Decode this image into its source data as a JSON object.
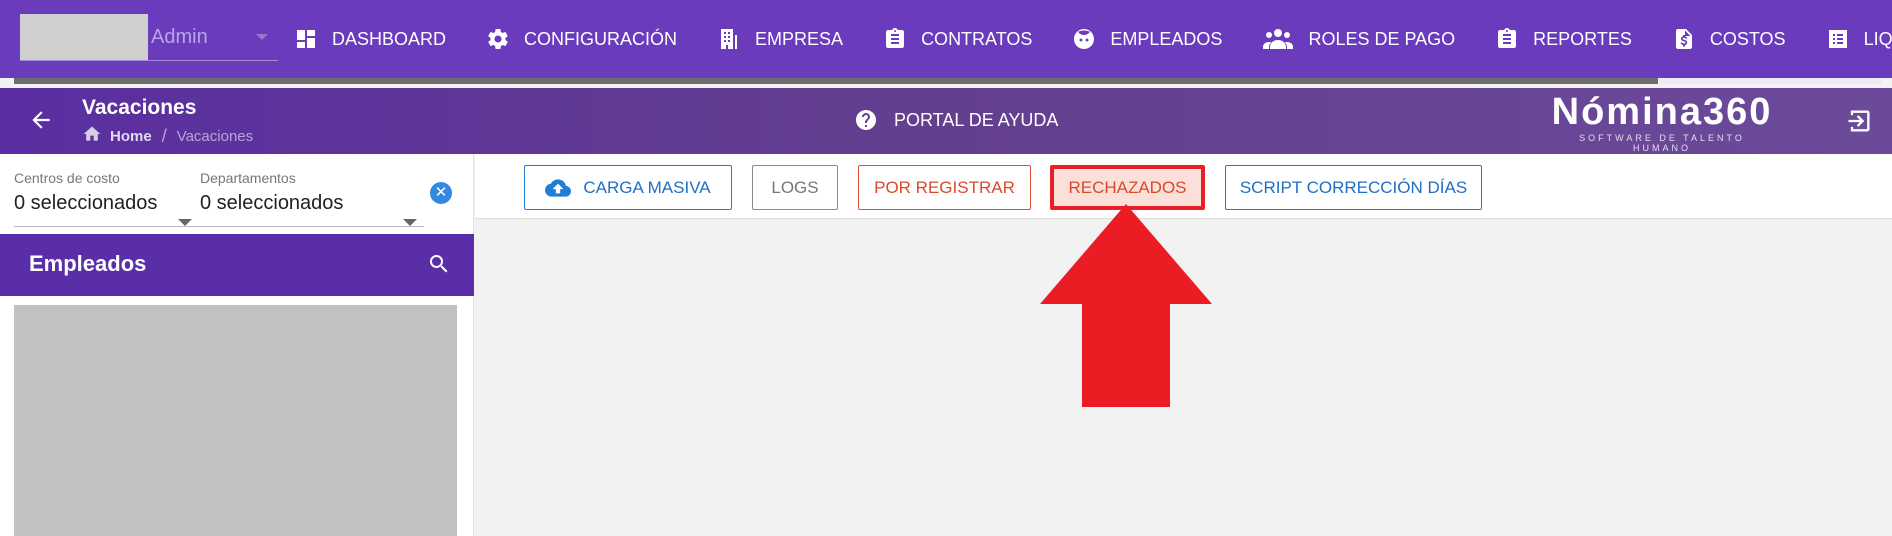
{
  "topnav": {
    "user_name": "Admin",
    "items": [
      {
        "label": "DASHBOARD",
        "icon": "dashboard-icon"
      },
      {
        "label": "CONFIGURACIÓN",
        "icon": "gear-icon"
      },
      {
        "label": "EMPRESA",
        "icon": "building-icon"
      },
      {
        "label": "CONTRATOS",
        "icon": "clipboard-icon"
      },
      {
        "label": "EMPLEADOS",
        "icon": "face-icon"
      },
      {
        "label": "ROLES DE PAGO",
        "icon": "people-icon"
      },
      {
        "label": "REPORTES",
        "icon": "clipboard-icon"
      },
      {
        "label": "COSTOS",
        "icon": "dollar-file-icon"
      },
      {
        "label": "LIQUIDACIONE",
        "icon": "list-icon"
      }
    ],
    "progress_fraction": 0.88
  },
  "subheader": {
    "title": "Vacaciones",
    "breadcrumb_home": "Home",
    "breadcrumb_sep": "/",
    "breadcrumb_current": "Vacaciones",
    "help_label": "PORTAL DE AYUDA",
    "brand_name": "Nómina360",
    "brand_tagline": "SOFTWARE DE TALENTO HUMANO"
  },
  "filters": {
    "centros_label": "Centros de costo",
    "centros_value": "0 seleccionados",
    "departamentos_label": "Departamentos",
    "departamentos_value": "0 seleccionados",
    "clear_symbol": "✕"
  },
  "employees": {
    "title": "Empleados"
  },
  "toolbar": {
    "carga_masiva": "CARGA MASIVA",
    "logs": "LOGS",
    "por_registrar": "POR REGISTRAR",
    "rechazados": "RECHAZADOS",
    "script_correccion": "SCRIPT CORRECCIÓN DÍAS"
  },
  "colors": {
    "nav_bg": "#6a3bbd",
    "accent_blue": "#1f7fd6",
    "accent_red": "#e5202b",
    "annotation_arrow": "#ec1c24"
  }
}
